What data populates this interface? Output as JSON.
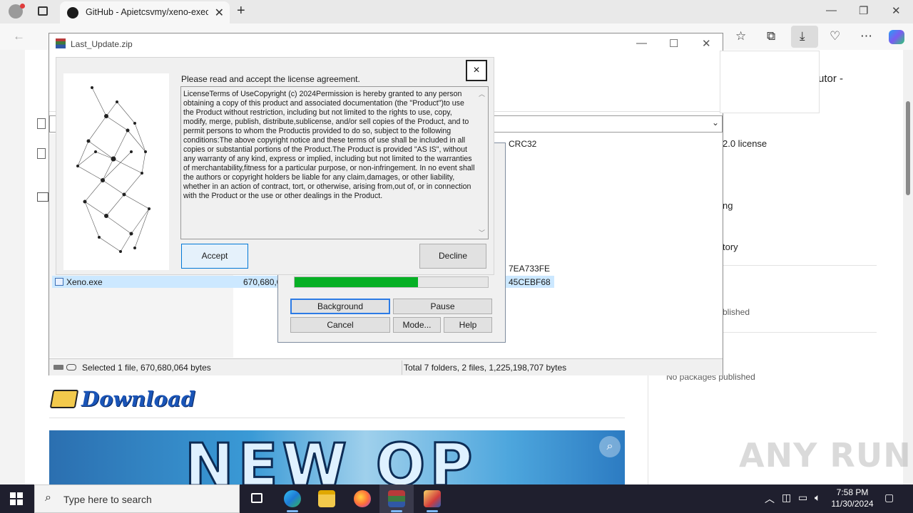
{
  "browser": {
    "tab_title": "GitHub - Apietcsvmy/xeno-exec",
    "tab_close": "✕",
    "new_tab": "+",
    "min": "—",
    "restore": "❐",
    "close": "✕"
  },
  "page": {
    "right_panel": {
      "about_tail": "utor -",
      "license": "2.0 license",
      "item_ng": "ng",
      "item_tory": "tory",
      "published": "blished",
      "no_packages": "No packages published"
    },
    "download_heading": "Download",
    "banner_text": "NEW OP"
  },
  "watermark": "ANY RUN",
  "winrar": {
    "title": "Last_Update.zip",
    "column_crc": "CRC32",
    "rows": [
      {
        "name": "",
        "size": "",
        "crc": "7EA733FE"
      },
      {
        "name": "Xeno.exe",
        "size": "670,680,0",
        "crc": "45CEBF68"
      }
    ],
    "status_left": "Selected 1 file, 670,680,064 bytes",
    "status_right": "Total 7 folders, 2 files, 1,225,198,707 bytes"
  },
  "progress_dialog": {
    "progress_fraction": 0.64,
    "buttons": {
      "background": "Background",
      "pause": "Pause",
      "cancel": "Cancel",
      "mode": "Mode...",
      "help": "Help"
    }
  },
  "license_dialog": {
    "heading": "Please read and accept the license agreement.",
    "text": "LicenseTerms of Use​Copyright (c) 2024​Permission is hereby granted to any person obtaining a copy of this product and associated documentation (the \"Product\")to use the Product without restriction, including but not limited to the rights to use, copy, modify, merge, publish, distribute,sublicense, and/or sell copies of the Product, and to permit persons to whom the Productis provided to do so, subject to the following conditions:The above copyright notice and these terms of use shall be included in all copies or substantial portions of the Product.The Product is provided \"AS IS\", without any warranty of any kind, express or implied, including but not limited to the warranties of merchantability,fitness for a particular purpose, or non-infringement. In no event shall the authors or copyright holders be liable for any claim,damages, or other liability, whether in an action of contract, tort, or otherwise, arising from,out of, or in connection with the Product or the use or other dealings in the Product.",
    "accept": "Accept",
    "decline": "Decline",
    "close": "×"
  },
  "taskbar": {
    "search_placeholder": "Type here to search",
    "time": "7:58 PM",
    "date": "11/30/2024"
  },
  "colors": {
    "progress_green": "#06b025",
    "accent_blue": "#0078d7",
    "taskbar_bg": "#1f1f2e"
  }
}
